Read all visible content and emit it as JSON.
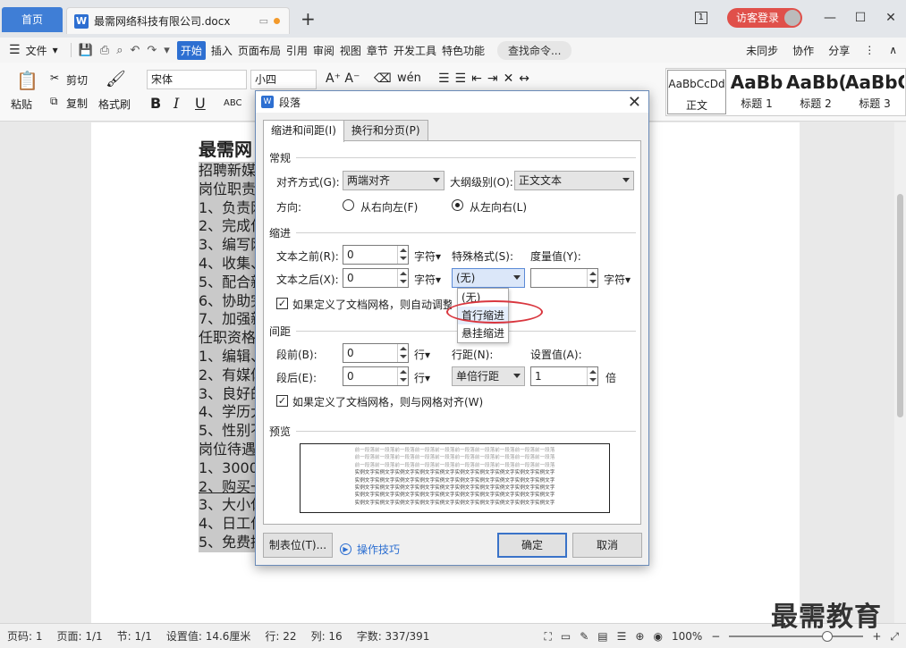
{
  "titlebar": {
    "home_tab": "首页",
    "doc_icon": "W",
    "doc_tab": "最需网络科技有限公司.docx",
    "doc_extra": "▭",
    "new_tab": "+",
    "badge": "1",
    "visitor_login": "访客登录",
    "minimize": "—",
    "maximize": "☐",
    "close": "✕"
  },
  "menubar": {
    "hamburger": "☰",
    "file": "文件",
    "file_arrow": "▾",
    "save_icon": "💾",
    "print_icon": "⎙",
    "preview_icon": "⌕",
    "undo_icon": "↶",
    "redo_icon": "↷",
    "more_icon": "▾",
    "items": [
      "开始",
      "插入",
      "页面布局",
      "引用",
      "审阅",
      "视图",
      "章节",
      "开发工具",
      "特色功能"
    ],
    "search": "查找命令...",
    "sync": "未同步",
    "collab": "协作",
    "share": "分享",
    "more": "⋮",
    "collapse": "∧"
  },
  "ribbon": {
    "paste": "粘贴",
    "cut": "剪切",
    "copy": "复制",
    "format_painter": "格式刷",
    "font_name": "宋体",
    "font_size": "小四",
    "bold": "B",
    "italic": "I",
    "underline": "U",
    "styles": [
      {
        "sample": "AaBbCcDd",
        "label": "正文"
      },
      {
        "sample": "AaBb",
        "label": "标题 1"
      },
      {
        "sample": "AaBb(",
        "label": "标题 2"
      },
      {
        "sample": "AaBbC",
        "label": "标题 3"
      }
    ]
  },
  "document": {
    "title": "最需网",
    "lines": [
      "招聘新媒",
      "岗位职责",
      "1、负责网",
      "2、完成作",
      "3、编写网",
      "4、收集、",
      "5、配合新",
      "6、协助完",
      "7、加强新",
      "任职资格",
      "1、编辑、",
      "2、有媒体",
      "3、良好的",
      "4、学历大",
      "5、性别不",
      "岗位待遇",
      "1、3000",
      "2、购买一",
      "3、大小休",
      "4、日工作",
      "5、免费提"
    ]
  },
  "dialog": {
    "title": "段落",
    "close": "✕",
    "tabs": [
      "缩进和间距(I)",
      "换行和分页(P)"
    ],
    "section_general": "常规",
    "align_label": "对齐方式(G):",
    "align_value": "两端对齐",
    "outline_label": "大纲级别(O):",
    "outline_value": "正文文本",
    "direction_label": "方向:",
    "rtl": "从右向左(F)",
    "ltr": "从左向右(L)",
    "section_indent": "缩进",
    "before_text_label": "文本之前(R):",
    "before_text_value": "0",
    "after_text_label": "文本之后(X):",
    "after_text_value": "0",
    "unit_char": "字符▾",
    "special_label": "特殊格式(S):",
    "special_value": "(无)",
    "measure_label": "度量值(Y):",
    "measure_value": "",
    "grid_indent": "如果定义了文档网格，则自动调整",
    "special_options": [
      "(无)",
      "首行缩进",
      "悬挂缩进"
    ],
    "section_spacing": "间距",
    "before_label": "段前(B):",
    "before_value": "0",
    "after_label": "段后(E):",
    "after_value": "0",
    "unit_line": "行▾",
    "line_spacing_label": "行距(N):",
    "line_spacing_value": "单倍行距",
    "setting_label": "设置值(A):",
    "setting_value": "1",
    "unit_times": "倍",
    "grid_align": "如果定义了文档网格，则与网格对齐(W)",
    "section_preview": "预览",
    "preview_prev_text": "前一段落前一段落前一段落前一段落前一段落前一段落前一段落前一段落前一段落前一段落",
    "preview_sample_text": "实例文字实例文字实例文字实例文字实例文字实例文字实例文字实例文字实例文字实例文字",
    "tabs_button": "制表位(T)...",
    "tips_icon": "▶",
    "tips": "操作技巧",
    "ok": "确定",
    "cancel": "取消"
  },
  "statusbar": {
    "page_num": "页码: 1",
    "page": "页面: 1/1",
    "section": "节: 1/1",
    "setting": "设置值: 14.6厘米",
    "row": "行: 22",
    "col": "列: 16",
    "words": "字数: 337/391",
    "zoom": "100%",
    "zoom_level": 0.73
  },
  "watermark": "最需教育",
  "colors": {
    "accent": "#2d6fd1",
    "home_tab": "#3f7ed6",
    "visitor": "#e0504a",
    "highlight_oval": "#d9363e"
  }
}
